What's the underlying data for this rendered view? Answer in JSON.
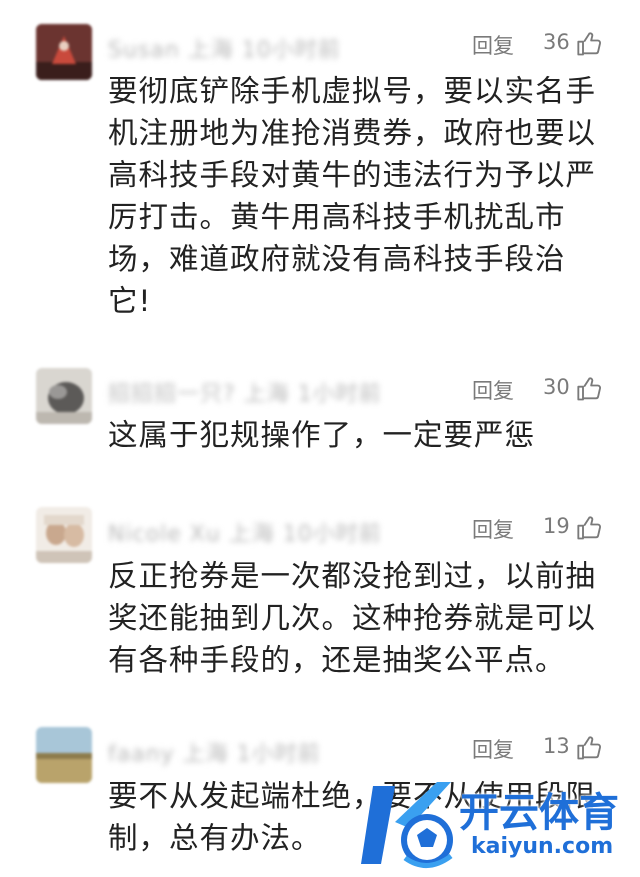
{
  "comments": [
    {
      "username": "Susan 上海 10小时前",
      "reply_label": "回复",
      "likes": "36",
      "lines": [
        "要彻底铲除手机虚拟号，要以实名手",
        "机注册地为准抢消费券，政府也要以",
        "高科技手段对黄牛的违法行为予以严",
        "厉打击。黄牛用高科技手机扰乱市",
        "场，难道政府就没有高科技手段治",
        "它!"
      ]
    },
    {
      "username": "招招招一只? 上海 1小时前",
      "reply_label": "回复",
      "likes": "30",
      "lines": [
        "这属于犯规操作了，一定要严惩"
      ]
    },
    {
      "username": "Nicole Xu 上海 10小时前",
      "reply_label": "回复",
      "likes": "19",
      "lines": [
        "反正抢券是一次都没抢到过，以前抽",
        "奖还能抽到几次。这种抢券就是可以",
        "有各种手段的，还是抽奖公平点。"
      ]
    },
    {
      "username": "faany 上海 1小时前",
      "reply_label": "回复",
      "likes": "13",
      "lines": [
        "要不从发起端杜绝，要不从使用段限",
        "制，总有办法。"
      ]
    }
  ],
  "watermark": {
    "cn": "开云体育",
    "en": "kaiyun.com"
  },
  "colors": {
    "accent": "#1f6fd8",
    "text": "#222222",
    "meta": "#7a7a7a"
  },
  "icons": {
    "like": "thumbs-up-icon",
    "watermark_logo": "kaiyun-logo-icon"
  }
}
